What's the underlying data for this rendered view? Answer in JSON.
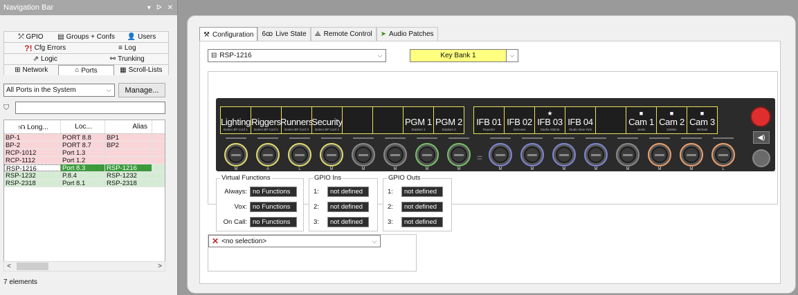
{
  "nav": {
    "title": "Navigation Bar",
    "title_buttons": [
      "▾",
      "ᐅ",
      "✕"
    ],
    "tab_rows": [
      [
        {
          "label": "GPIO",
          "icon": "gpio-icon",
          "glyph": "⤱"
        },
        {
          "label": "Groups + Confs",
          "icon": "groups-icon",
          "glyph": "▤"
        },
        {
          "label": "Users",
          "icon": "users-icon",
          "glyph": "👤"
        }
      ],
      [
        {
          "label": "Cfg Errors",
          "icon": "error-icon",
          "glyph": "?!"
        },
        {
          "label": "Log",
          "icon": "log-icon",
          "glyph": "≡"
        }
      ],
      [
        {
          "label": "Logic",
          "icon": "logic-icon",
          "glyph": "⇗"
        },
        {
          "label": "Trunking",
          "icon": "trunking-icon",
          "glyph": "⚯"
        }
      ],
      [
        {
          "label": "Network",
          "icon": "network-icon",
          "glyph": "⊞"
        },
        {
          "label": "Ports",
          "icon": "ports-icon",
          "glyph": "⌂",
          "active": true
        },
        {
          "label": "Scroll-Lists",
          "icon": "scroll-list-icon",
          "glyph": "▦"
        }
      ]
    ],
    "port_filter": "All Ports in the System",
    "manage_label": "Manage...",
    "filter_value": "",
    "columns": [
      "Long...",
      "Loc...",
      "Alias"
    ],
    "rows": [
      {
        "long": "BP-1",
        "loc": "PORT 8.8",
        "alias": "BP1",
        "state": "pink"
      },
      {
        "long": "BP-2",
        "loc": "PORT 8.7",
        "alias": "BP2",
        "state": "pink"
      },
      {
        "long": "RCP-1012",
        "loc": "Port 1.3",
        "alias": "",
        "state": "pink"
      },
      {
        "long": "RCP-1112",
        "loc": "Port 1.2",
        "alias": "",
        "state": "pink"
      },
      {
        "long": "RSP-1216",
        "loc": "Port 8.3",
        "alias": "RSP-1216",
        "state": "sel"
      },
      {
        "long": "RSP-1232",
        "loc": "P.8.4",
        "alias": "RSP-1232",
        "state": "green"
      },
      {
        "long": "RSP-2318",
        "loc": "Port 8.1",
        "alias": "RSP-2318",
        "state": "green"
      }
    ],
    "status": "7 elements"
  },
  "main": {
    "tabs": [
      {
        "label": "Configuration",
        "icon": "tools-icon",
        "glyph": "⚒",
        "active": true
      },
      {
        "label": "Live State",
        "icon": "binoculars-icon",
        "glyph": "6ꝏ"
      },
      {
        "label": "Remote Control",
        "icon": "remote-icon",
        "glyph": "⟁"
      },
      {
        "label": "Audio Patches",
        "icon": "audio-patch-icon",
        "glyph": "➤"
      }
    ],
    "device": "RSP-1216",
    "bank": "Key Bank 1",
    "keys": [
      {
        "title": "Lighting",
        "sub": "Bolero BP Conf 1",
        "icon": ""
      },
      {
        "title": "Riggers",
        "sub": "Bolero BP Conf 2",
        "icon": ""
      },
      {
        "title": "Runners",
        "sub": "Bolero BP Conf 3",
        "icon": ""
      },
      {
        "title": "Security",
        "sub": "Bolero BP Conf 4",
        "icon": ""
      },
      {
        "title": "",
        "sub": "",
        "icon": ""
      },
      {
        "title": "",
        "sub": "",
        "icon": ""
      },
      {
        "title": "PGM 1",
        "sub": "Stadium 1",
        "icon": ""
      },
      {
        "title": "PGM 2",
        "sub": "Stadium 2",
        "icon": ""
      },
      {
        "title": "IFB 01",
        "sub": "Reporter",
        "icon": ""
      },
      {
        "title": "IFB 02",
        "sub": "Interview",
        "icon": ""
      },
      {
        "title": "IFB 03",
        "sub": "Studio Atlanta",
        "icon": "★"
      },
      {
        "title": "IFB 04",
        "sub": "Studio New York",
        "icon": ""
      },
      {
        "title": "",
        "sub": "",
        "icon": ""
      },
      {
        "title": "Cam 1",
        "sub": "Justin",
        "icon": "■"
      },
      {
        "title": "Cam 2",
        "sub": "Debbie",
        "icon": "■"
      },
      {
        "title": "Cam 3",
        "sub": "Michael",
        "icon": "■"
      }
    ],
    "knobs": [
      {
        "label": "M",
        "color": "#e3dc6c"
      },
      {
        "label": "A",
        "color": "#e3dc6c"
      },
      {
        "label": "L",
        "color": "#e3dc6c"
      },
      {
        "label": "M",
        "color": "#e3dc6c"
      },
      {
        "label": "M",
        "color": "#8a8a8a"
      },
      {
        "label": "M",
        "color": "#8a8a8a"
      },
      {
        "label": "M",
        "color": "#78c26a"
      },
      {
        "label": "M",
        "color": "#78c26a"
      },
      {
        "label": "M",
        "color": "#7f87d8"
      },
      {
        "label": "M",
        "color": "#7f87d8"
      },
      {
        "label": "M",
        "color": "#7f87d8"
      },
      {
        "label": "M",
        "color": "#7f87d8"
      },
      {
        "label": "M",
        "color": "#8a8a8a"
      },
      {
        "label": "M",
        "color": "#f0a06a"
      },
      {
        "label": "M",
        "color": "#f0a06a"
      },
      {
        "label": "L",
        "color": "#f0a06a"
      }
    ],
    "virtual_functions": {
      "title": "Virtual Functions",
      "rows": [
        {
          "label": "Always:",
          "value": "no Functions"
        },
        {
          "label": "Vox:",
          "value": "no Functions"
        },
        {
          "label": "On Call:",
          "value": "no Functions"
        }
      ]
    },
    "gpio_ins": {
      "title": "GPIO Ins",
      "rows": [
        {
          "label": "1:",
          "value": "not defined"
        },
        {
          "label": "2:",
          "value": "not defined"
        },
        {
          "label": "3:",
          "value": "not defined"
        }
      ]
    },
    "gpio_outs": {
      "title": "GPIO Outs",
      "rows": [
        {
          "label": "1:",
          "value": "not defined"
        },
        {
          "label": "2:",
          "value": "not defined"
        },
        {
          "label": "3:",
          "value": "not defined"
        }
      ]
    },
    "selection": "<no selection>"
  }
}
